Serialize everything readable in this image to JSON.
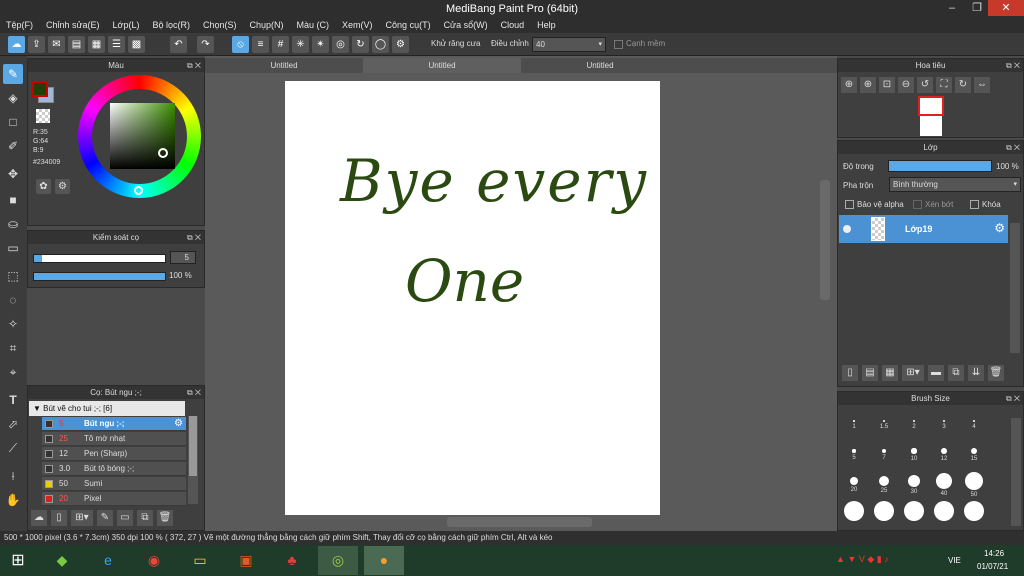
{
  "window": {
    "title": "MediBang Paint Pro (64bit)"
  },
  "menu": [
    "Tệp(F)",
    "Chỉnh sửa(E)",
    "Lớp(L)",
    "Bộ lọc(R)",
    "Chọn(S)",
    "Chụp(N)",
    "Màu (C)",
    "Xem(V)",
    "Công cụ(T)",
    "Cửa sổ(W)",
    "Cloud",
    "Help"
  ],
  "toolbar": {
    "antialias_label": "Khử răng cưa",
    "adjust_label": "Điều chỉnh",
    "adjust_value": "40",
    "soft_edge_label": "Cạnh mềm"
  },
  "color_panel": {
    "title": "Màu",
    "r": "R:35",
    "g": "G:64",
    "b": "B:9",
    "hex": "#234009",
    "primary_color": "#234009",
    "secondary_color": "#9fb8d8"
  },
  "brush_control": {
    "title": "Kiểm soát cọ",
    "size_value": "5",
    "opacity_value": "100 %"
  },
  "brush_list": {
    "title": "Cọ: Bút ngu ;-;",
    "group": "Bút vẽ cho tui ;-; [6]",
    "items": [
      {
        "size": "5",
        "name": "Bút ngu ;-;",
        "color": "#333333",
        "selected": true
      },
      {
        "size": "25",
        "name": "Tô mờ nhạt",
        "color": "#333333",
        "selected": false
      },
      {
        "size": "12",
        "name": "Pen (Sharp)",
        "color": "#333333",
        "selected": false
      },
      {
        "size": "3.0",
        "name": "Bút tô bóng ;-;",
        "color": "#333333",
        "selected": false
      },
      {
        "size": "50",
        "name": "Sumi",
        "color": "#e8d000",
        "selected": false
      },
      {
        "size": "20",
        "name": "Pixel",
        "color": "#e02020",
        "selected": false
      }
    ]
  },
  "tabs": [
    "Untitled",
    "Untitled",
    "Untitled"
  ],
  "canvas": {
    "line1": "Bye every",
    "line2": "One",
    "ink_color": "#2b4a12"
  },
  "navigator": {
    "title": "Hoa tiêu"
  },
  "layers": {
    "title": "Lớp",
    "opacity_label": "Độ trong",
    "opacity_value": "100 %",
    "blend_label": "Pha trộn",
    "blend_value": "Bình thường",
    "protect_alpha": "Bảo vệ alpha",
    "clip": "Xén bớt",
    "lock": "Khóa",
    "layer_name": "Lớp19"
  },
  "brush_size": {
    "title": "Brush Size",
    "sizes": [
      "1",
      "1.5",
      "2",
      "3",
      "4",
      "5",
      "7",
      "10",
      "12",
      "15",
      "20",
      "25",
      "30",
      "40",
      "50"
    ]
  },
  "status": {
    "text": "500 * 1000 pixel   (3.6 * 7.3cm)   350 dpi   100 %   ( 372, 27 )   Vẽ một đường thẳng bằng cách giữ phím Shift, Thay đổi cỡ cọ bằng cách giữ phím Ctrl, Alt và kéo"
  },
  "taskbar": {
    "lang": "VIE",
    "time": "14:26",
    "date": "01/07/21"
  }
}
